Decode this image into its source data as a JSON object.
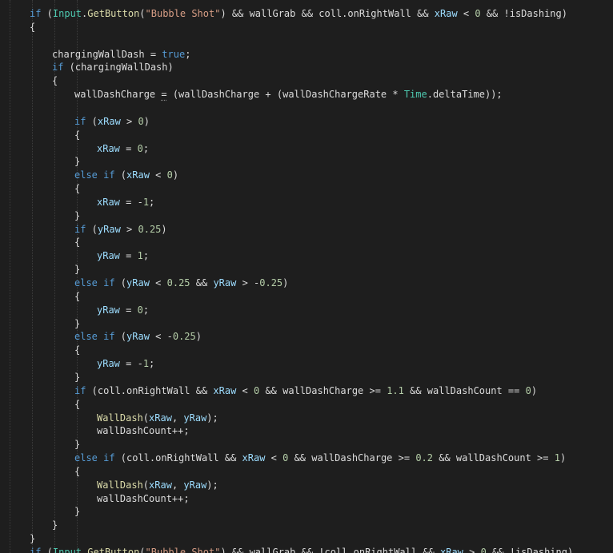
{
  "editor": {
    "lines": [
      {
        "indent": 1,
        "tokens": [
          [
            "kw",
            "if"
          ],
          [
            "plain",
            " ("
          ],
          [
            "type",
            "Input"
          ],
          [
            "plain",
            "."
          ],
          [
            "fn",
            "GetButton"
          ],
          [
            "plain",
            "("
          ],
          [
            "str",
            "\"Bubble Shot\""
          ],
          [
            "plain",
            ") && wallGrab && coll.onRightWall && "
          ],
          [
            "var",
            "xRaw"
          ],
          [
            "plain",
            " < "
          ],
          [
            "num",
            "0"
          ],
          [
            "plain",
            " && !isDashing)"
          ]
        ]
      },
      {
        "indent": 1,
        "tokens": [
          [
            "plain",
            "{"
          ]
        ]
      },
      {
        "indent": 0,
        "tokens": []
      },
      {
        "indent": 2,
        "tokens": [
          [
            "plain",
            "chargingWallDash = "
          ],
          [
            "kw",
            "true"
          ],
          [
            "plain",
            ";"
          ]
        ]
      },
      {
        "indent": 2,
        "tokens": [
          [
            "kw",
            "if"
          ],
          [
            "plain",
            " (chargingWallDash)"
          ]
        ]
      },
      {
        "indent": 2,
        "tokens": [
          [
            "plain",
            "{"
          ]
        ]
      },
      {
        "indent": 3,
        "tokens": [
          [
            "plain",
            "wallDashCharge "
          ],
          [
            "squiggle",
            "="
          ],
          [
            "plain",
            " (wallDashCharge + (wallDashChargeRate * "
          ],
          [
            "type",
            "Time"
          ],
          [
            "plain",
            ".deltaTime));"
          ]
        ]
      },
      {
        "indent": 0,
        "tokens": []
      },
      {
        "indent": 3,
        "tokens": [
          [
            "kw",
            "if"
          ],
          [
            "plain",
            " ("
          ],
          [
            "var",
            "xRaw"
          ],
          [
            "plain",
            " > "
          ],
          [
            "num",
            "0"
          ],
          [
            "plain",
            ")"
          ]
        ]
      },
      {
        "indent": 3,
        "tokens": [
          [
            "plain",
            "{"
          ]
        ]
      },
      {
        "indent": 4,
        "tokens": [
          [
            "var",
            "xRaw"
          ],
          [
            "plain",
            " = "
          ],
          [
            "num",
            "0"
          ],
          [
            "plain",
            ";"
          ]
        ]
      },
      {
        "indent": 3,
        "tokens": [
          [
            "plain",
            "}"
          ]
        ]
      },
      {
        "indent": 3,
        "tokens": [
          [
            "kw",
            "else if"
          ],
          [
            "plain",
            " ("
          ],
          [
            "var",
            "xRaw"
          ],
          [
            "plain",
            " < "
          ],
          [
            "num",
            "0"
          ],
          [
            "plain",
            ")"
          ]
        ]
      },
      {
        "indent": 3,
        "tokens": [
          [
            "plain",
            "{"
          ]
        ]
      },
      {
        "indent": 4,
        "tokens": [
          [
            "var",
            "xRaw"
          ],
          [
            "plain",
            " = -"
          ],
          [
            "num",
            "1"
          ],
          [
            "plain",
            ";"
          ]
        ]
      },
      {
        "indent": 3,
        "tokens": [
          [
            "plain",
            "}"
          ]
        ]
      },
      {
        "indent": 3,
        "tokens": [
          [
            "kw",
            "if"
          ],
          [
            "plain",
            " ("
          ],
          [
            "var",
            "yRaw"
          ],
          [
            "plain",
            " > "
          ],
          [
            "num",
            "0.25"
          ],
          [
            "plain",
            ")"
          ]
        ]
      },
      {
        "indent": 3,
        "tokens": [
          [
            "plain",
            "{"
          ]
        ]
      },
      {
        "indent": 4,
        "tokens": [
          [
            "var",
            "yRaw"
          ],
          [
            "plain",
            " = "
          ],
          [
            "num",
            "1"
          ],
          [
            "plain",
            ";"
          ]
        ]
      },
      {
        "indent": 3,
        "tokens": [
          [
            "plain",
            "}"
          ]
        ]
      },
      {
        "indent": 3,
        "tokens": [
          [
            "kw",
            "else if"
          ],
          [
            "plain",
            " ("
          ],
          [
            "var",
            "yRaw"
          ],
          [
            "plain",
            " < "
          ],
          [
            "num",
            "0.25"
          ],
          [
            "plain",
            " && "
          ],
          [
            "var",
            "yRaw"
          ],
          [
            "plain",
            " > -"
          ],
          [
            "num",
            "0.25"
          ],
          [
            "plain",
            ")"
          ]
        ]
      },
      {
        "indent": 3,
        "tokens": [
          [
            "plain",
            "{"
          ]
        ]
      },
      {
        "indent": 4,
        "tokens": [
          [
            "var",
            "yRaw"
          ],
          [
            "plain",
            " = "
          ],
          [
            "num",
            "0"
          ],
          [
            "plain",
            ";"
          ]
        ]
      },
      {
        "indent": 3,
        "tokens": [
          [
            "plain",
            "}"
          ]
        ]
      },
      {
        "indent": 3,
        "tokens": [
          [
            "kw",
            "else if"
          ],
          [
            "plain",
            " ("
          ],
          [
            "var",
            "yRaw"
          ],
          [
            "plain",
            " < -"
          ],
          [
            "num",
            "0.25"
          ],
          [
            "plain",
            ")"
          ]
        ]
      },
      {
        "indent": 3,
        "tokens": [
          [
            "plain",
            "{"
          ]
        ]
      },
      {
        "indent": 4,
        "tokens": [
          [
            "var",
            "yRaw"
          ],
          [
            "plain",
            " = -"
          ],
          [
            "num",
            "1"
          ],
          [
            "plain",
            ";"
          ]
        ]
      },
      {
        "indent": 3,
        "tokens": [
          [
            "plain",
            "}"
          ]
        ]
      },
      {
        "indent": 3,
        "tokens": [
          [
            "kw",
            "if"
          ],
          [
            "plain",
            " (coll.onRightWall && "
          ],
          [
            "var",
            "xRaw"
          ],
          [
            "plain",
            " < "
          ],
          [
            "num",
            "0"
          ],
          [
            "plain",
            " && wallDashCharge >= "
          ],
          [
            "num",
            "1.1"
          ],
          [
            "plain",
            " && wallDashCount == "
          ],
          [
            "num",
            "0"
          ],
          [
            "plain",
            ")"
          ]
        ]
      },
      {
        "indent": 3,
        "tokens": [
          [
            "plain",
            "{"
          ]
        ]
      },
      {
        "indent": 4,
        "tokens": [
          [
            "fn",
            "WallDash"
          ],
          [
            "plain",
            "("
          ],
          [
            "var",
            "xRaw"
          ],
          [
            "plain",
            ", "
          ],
          [
            "var",
            "yRaw"
          ],
          [
            "plain",
            ");"
          ]
        ]
      },
      {
        "indent": 4,
        "tokens": [
          [
            "plain",
            "wallDashCount++;"
          ]
        ]
      },
      {
        "indent": 3,
        "tokens": [
          [
            "plain",
            "}"
          ]
        ]
      },
      {
        "indent": 3,
        "tokens": [
          [
            "kw",
            "else if"
          ],
          [
            "plain",
            " (coll.onRightWall && "
          ],
          [
            "var",
            "xRaw"
          ],
          [
            "plain",
            " < "
          ],
          [
            "num",
            "0"
          ],
          [
            "plain",
            " && wallDashCharge >= "
          ],
          [
            "num",
            "0.2"
          ],
          [
            "plain",
            " && wallDashCount >= "
          ],
          [
            "num",
            "1"
          ],
          [
            "plain",
            ")"
          ]
        ]
      },
      {
        "indent": 3,
        "tokens": [
          [
            "plain",
            "{"
          ]
        ]
      },
      {
        "indent": 4,
        "tokens": [
          [
            "fn",
            "WallDash"
          ],
          [
            "plain",
            "("
          ],
          [
            "var",
            "xRaw"
          ],
          [
            "plain",
            ", "
          ],
          [
            "var",
            "yRaw"
          ],
          [
            "plain",
            ");"
          ]
        ]
      },
      {
        "indent": 4,
        "tokens": [
          [
            "plain",
            "wallDashCount++;"
          ]
        ]
      },
      {
        "indent": 3,
        "tokens": [
          [
            "plain",
            "}"
          ]
        ]
      },
      {
        "indent": 2,
        "tokens": [
          [
            "plain",
            "}"
          ]
        ]
      },
      {
        "indent": 1,
        "tokens": [
          [
            "plain",
            "}"
          ]
        ]
      },
      {
        "indent": 1,
        "tokens": [
          [
            "kw",
            "if"
          ],
          [
            "plain",
            " ("
          ],
          [
            "type",
            "Input"
          ],
          [
            "plain",
            "."
          ],
          [
            "fn",
            "GetButton"
          ],
          [
            "plain",
            "("
          ],
          [
            "str",
            "\"Bubble Shot\""
          ],
          [
            "plain",
            ") && wallGrab && !coll.onRightWall && "
          ],
          [
            "var",
            "xRaw"
          ],
          [
            "plain",
            " > "
          ],
          [
            "num",
            "0"
          ],
          [
            "plain",
            " && !isDashing)"
          ]
        ]
      }
    ]
  },
  "colors": {
    "background": "#1e1e1e",
    "plain": "#dcdcdc",
    "keyword": "#569cd6",
    "string": "#d69d85",
    "type": "#4ec9b0",
    "variable": "#9cdcfe",
    "number": "#b5cea8",
    "method": "#dcdcaa"
  }
}
